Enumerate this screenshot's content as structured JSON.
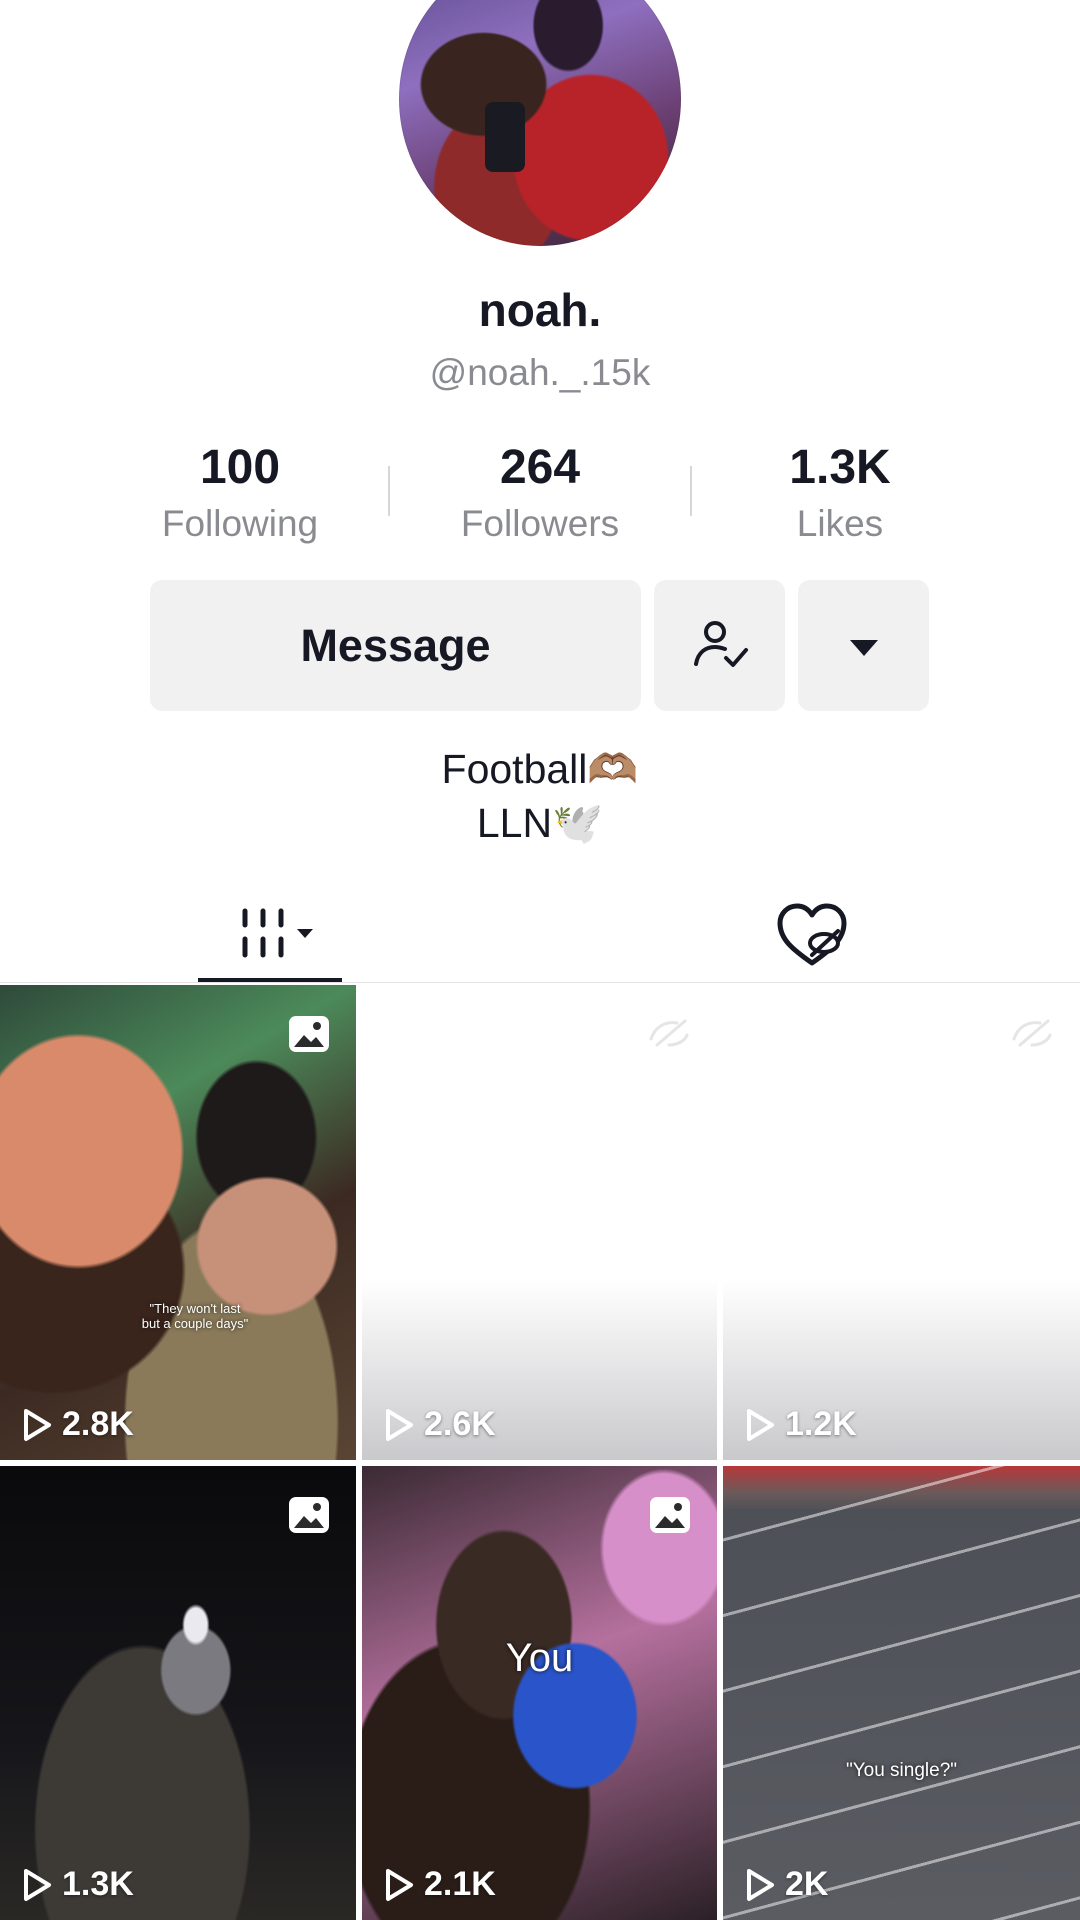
{
  "profile": {
    "display_name": "noah.",
    "username": "@noah._.15k",
    "avatar_icon": "profile-photo"
  },
  "stats": [
    {
      "value": "100",
      "label": "Following"
    },
    {
      "value": "264",
      "label": "Followers"
    },
    {
      "value": "1.3K",
      "label": "Likes"
    }
  ],
  "actions": {
    "message_label": "Message",
    "following_icon": "person-check-icon",
    "more_icon": "caret-down-icon"
  },
  "bio": {
    "line1": "Football🫶🏽",
    "line2": "LLN🕊️"
  },
  "tabs": [
    {
      "name": "videos",
      "icon": "videos-grid-icon",
      "active": true
    },
    {
      "name": "liked",
      "icon": "liked-hidden-icon",
      "active": false
    }
  ],
  "videos": [
    {
      "views": "2.8K",
      "type": "photo",
      "caption": "\"They won't last but a couple days\""
    },
    {
      "views": "2.6K",
      "type": "private"
    },
    {
      "views": "1.2K",
      "type": "private"
    },
    {
      "views": "1.3K",
      "type": "photo"
    },
    {
      "views": "2.1K",
      "type": "photo",
      "caption": "You"
    },
    {
      "views": "2K",
      "type": "video",
      "caption": "\"You single?\""
    }
  ],
  "colors": {
    "text_primary": "#161823",
    "text_secondary": "#8a8b91",
    "button_bg": "#f1f1f2"
  }
}
